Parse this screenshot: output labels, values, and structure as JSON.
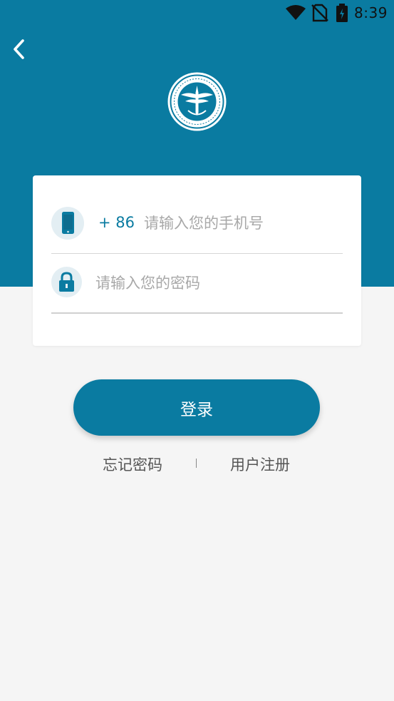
{
  "status_bar": {
    "time": "8:39",
    "icons": [
      "wifi-icon",
      "no-sim-icon",
      "battery-icon"
    ]
  },
  "header": {
    "back_icon": "back-arrow-icon",
    "logo": "institution-emblem-logo"
  },
  "form": {
    "phone": {
      "icon": "phone-icon",
      "country_code": "+ 86",
      "value": "",
      "placeholder": "请输入您的手机号"
    },
    "password": {
      "icon": "lock-icon",
      "value": "",
      "placeholder": "请输入您的密码"
    }
  },
  "actions": {
    "login_label": "登录",
    "forgot_label": "忘记密码",
    "register_label": "用户注册"
  },
  "colors": {
    "primary": "#0a7ba1",
    "background": "#f5f5f5",
    "card": "#ffffff",
    "placeholder": "#a8a8a8",
    "link_text": "#555555"
  }
}
